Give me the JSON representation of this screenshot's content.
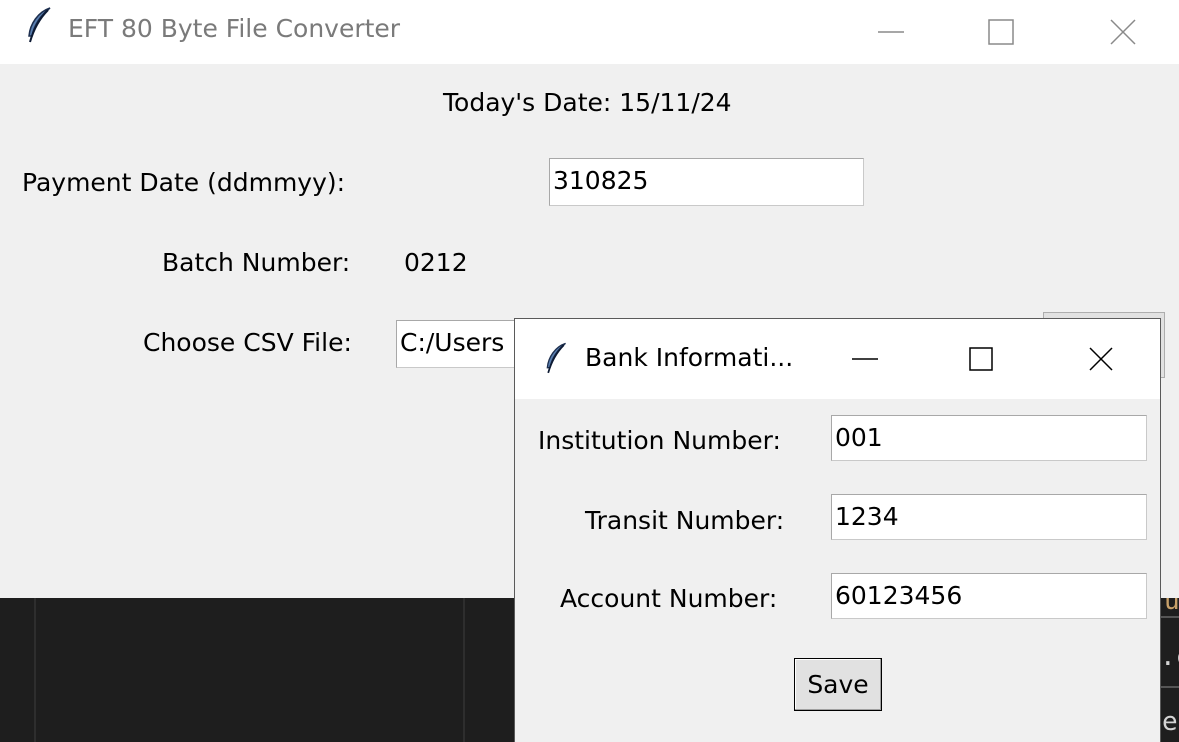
{
  "main_window": {
    "title": "EFT 80 Byte File Converter",
    "todays_date": "Today's Date: 15/11/24",
    "payment_date_label": "Payment Date (ddmmyy):",
    "payment_date_value": "310825",
    "batch_label": "Batch Number:",
    "batch_value": "0212",
    "csv_label": "Choose CSV File:",
    "csv_value": "C:/Users"
  },
  "dialog": {
    "title": "Bank Informati...",
    "institution_label": "Institution Number:",
    "institution_value": "001",
    "transit_label": "Transit Number:",
    "transit_value": "1234",
    "account_label": "Account Number:",
    "account_value": "60123456",
    "save_label": "Save"
  },
  "background_peek": {
    "line1": "u",
    "line2": ".c",
    "line3": "et"
  },
  "icons": {
    "app": "feather-icon",
    "minimize": "minimize-icon",
    "maximize": "maximize-icon",
    "close": "close-icon"
  }
}
